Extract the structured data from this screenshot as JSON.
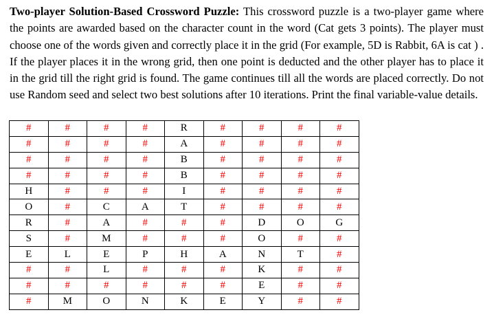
{
  "problem": {
    "title": "Two-player Solution-Based Crossword Puzzle:",
    "text": " This crossword puzzle is a two-player game where the points are awarded based on the character count in the word (Cat gets 3 points). The player must choose one of the words given and correctly place it in the grid (For example, 5D is Rabbit, 6A is cat ) . If the player places it in the wrong grid, then one point is deducted and the other player has to place it in the grid till the right grid is found. The game continues till all the words are placed correctly. Do not use Random seed and select two best solutions after 10 iterations. Print the final variable-value details."
  },
  "colors": {
    "blank_marker": "#ff0000",
    "letter": "#000000"
  },
  "grid": [
    [
      "#",
      "#",
      "#",
      "#",
      "R",
      "#",
      "#",
      "#",
      "#"
    ],
    [
      "#",
      "#",
      "#",
      "#",
      "A",
      "#",
      "#",
      "#",
      "#"
    ],
    [
      "#",
      "#",
      "#",
      "#",
      "B",
      "#",
      "#",
      "#",
      "#"
    ],
    [
      "#",
      "#",
      "#",
      "#",
      "B",
      "#",
      "#",
      "#",
      "#"
    ],
    [
      "H",
      "#",
      "#",
      "#",
      "I",
      "#",
      "#",
      "#",
      "#"
    ],
    [
      "O",
      "#",
      "C",
      "A",
      "T",
      "#",
      "#",
      "#",
      "#"
    ],
    [
      "R",
      "#",
      "A",
      "#",
      "#",
      "#",
      "D",
      "O",
      "G"
    ],
    [
      "S",
      "#",
      "M",
      "#",
      "#",
      "#",
      "O",
      "#",
      "#"
    ],
    [
      "E",
      "L",
      "E",
      "P",
      "H",
      "A",
      "N",
      "T",
      "#"
    ],
    [
      "#",
      "#",
      "L",
      "#",
      "#",
      "#",
      "K",
      "#",
      "#"
    ],
    [
      "#",
      "#",
      "#",
      "#",
      "#",
      "#",
      "E",
      "#",
      "#"
    ],
    [
      "#",
      "M",
      "O",
      "N",
      "K",
      "E",
      "Y",
      "#",
      "#"
    ]
  ]
}
